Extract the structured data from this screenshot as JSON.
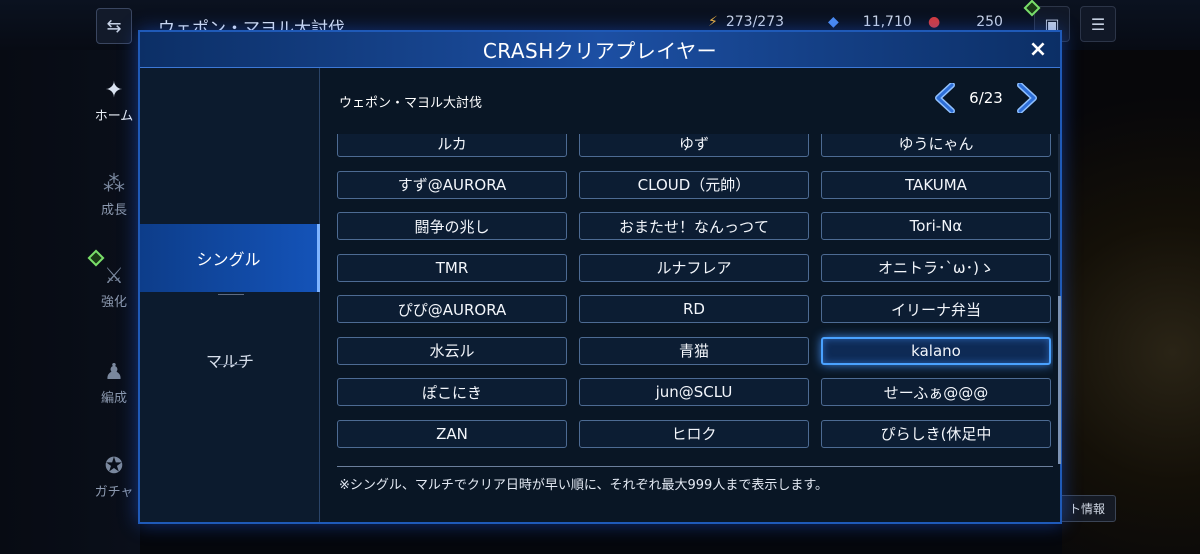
{
  "background": {
    "title": "ウェポン・マヨル大討伐",
    "resources": {
      "stamina": "273/273",
      "crystals": "11,710",
      "gems": "250"
    },
    "nav": [
      {
        "label": "ホーム",
        "icon": "home-icon"
      },
      {
        "label": "成長",
        "icon": "growth-icon"
      },
      {
        "label": "強化",
        "icon": "upgrade-icon"
      },
      {
        "label": "編成",
        "icon": "party-icon"
      },
      {
        "label": "ガチャ",
        "icon": "gacha-icon"
      }
    ],
    "info_button": "ト情報"
  },
  "dialog": {
    "title": "CRASHクリアプレイヤー",
    "close_label": "×",
    "tabs": [
      {
        "label": "シングル",
        "active": true
      },
      {
        "label": "マルチ",
        "active": false
      }
    ],
    "section_title": "ウェポン・マヨル大討伐",
    "pager": {
      "label": "6/23",
      "current": 6,
      "total": 23
    },
    "players": [
      "ルカ",
      "ゆず",
      "ゆうにゃん",
      "すず@AURORA",
      "CLOUD（元帥）",
      "TAKUMA",
      "闘争の兆し",
      "おまたせ！なんっつて",
      "Tori-Nα",
      "TMR",
      "ルナフレア",
      "オニトラ･`ω･)ゝ",
      "ぴぴ@AURORA",
      "RD",
      "イリーナ弁当",
      "水云ル",
      "青猫",
      "kalano",
      "ぽこにき",
      "jun@SCLU",
      "せーふぁ@@@",
      "ZAN",
      "ヒロク",
      "ぴらしき(休足中"
    ],
    "selected_player": "kalano",
    "footnote": "※シングル、マルチでクリア日時が早い順に、それぞれ最大999人まで表示します。"
  },
  "colors": {
    "accent": "#1f5ab8",
    "selected_glow": "#4aa2ff",
    "panel_bg": "#091625"
  }
}
